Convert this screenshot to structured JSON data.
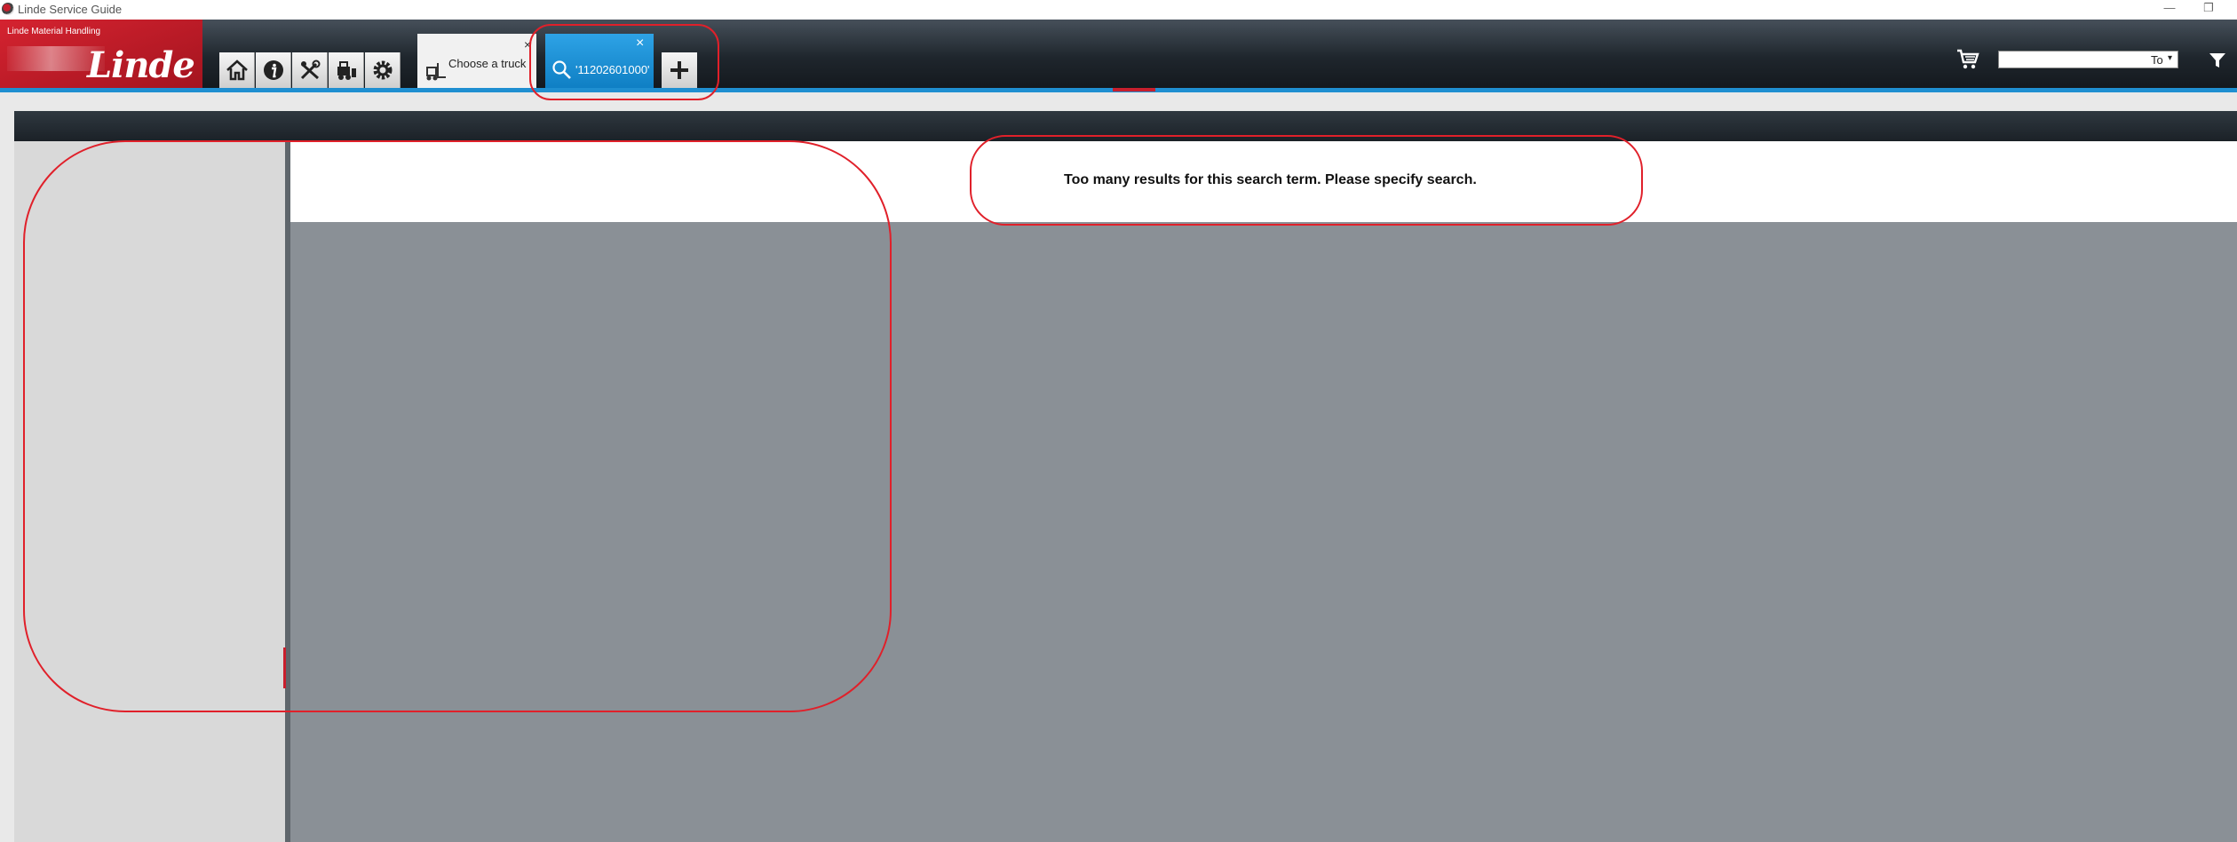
{
  "window": {
    "title": "Linde Service Guide",
    "minimize": "—",
    "restore": "❐"
  },
  "logo": {
    "company": "Linde Material Handling",
    "brand": "Linde"
  },
  "toolbar": {
    "buttons": [
      "home-icon",
      "info-icon",
      "tools-icon",
      "truck-parts-icon",
      "settings-icon"
    ]
  },
  "tabs": [
    {
      "label": "Choose a truck",
      "close": "×",
      "icon": "forklift-icon"
    },
    {
      "label": "'11202601000'",
      "close": "×",
      "icon": "search-icon"
    }
  ],
  "add_tab": "+",
  "search": {
    "value": "",
    "scope_label": "To",
    "caret": "▾"
  },
  "main": {
    "message": "Too many results for this search term. Please specify search."
  },
  "colors": {
    "brand_red": "#c81f2d",
    "accent_blue": "#1f8fd1",
    "annotation_red": "#e0202a"
  }
}
